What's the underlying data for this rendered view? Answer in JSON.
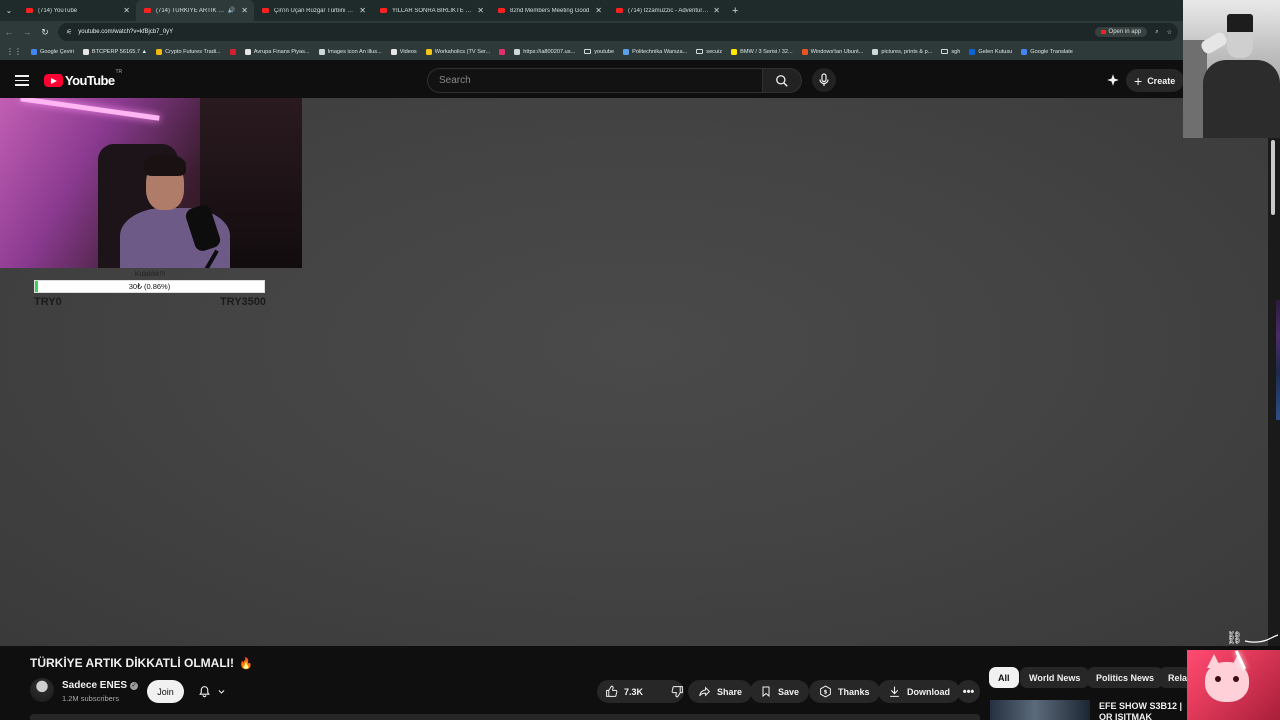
{
  "browser": {
    "tabs": [
      {
        "title": "(714) YouTube",
        "active": false
      },
      {
        "title": "(714) TÜRKİYE ARTIK DİKKATLİ",
        "active": true
      },
      {
        "title": "Çin'in Uçan Rüzgar Türbini Rek",
        "active": false
      },
      {
        "title": "YILLAR SONRA BİRLİKTE DENEY",
        "active": false
      },
      {
        "title": "82nd Members Meeting Good",
        "active": false
      },
      {
        "title": "(714) Izzamuzzic - Adventure (I",
        "active": false
      }
    ],
    "url": "youtube.com/watch?v=kfBjcb7_0yY",
    "open_in_app_label": "Open in app",
    "bookmarks": [
      {
        "label": "Google Çeviri",
        "icon": "google-translate-icon",
        "color": "#4285f4"
      },
      {
        "label": "BTCPERP 56165.7 ▲",
        "icon": "tradingview-icon",
        "color": "#e6e6e6"
      },
      {
        "label": "Crypto Futures Tradi...",
        "icon": "binance-icon",
        "color": "#f0b90b"
      },
      {
        "label": "",
        "icon": "flag-icon",
        "color": "#d61f2c"
      },
      {
        "label": "Avrupa Finans Piyas...",
        "icon": "investing-icon",
        "color": "#e6e6e6"
      },
      {
        "label": "Images icon An illus...",
        "icon": "page-icon",
        "color": "#cfd8d8"
      },
      {
        "label": "Videos",
        "icon": "video-icon",
        "color": "#e6e6e6"
      },
      {
        "label": "Workaholics (TV Ser...",
        "icon": "imdb-icon",
        "color": "#f5c518"
      },
      {
        "label": "",
        "icon": "instagram-icon",
        "color": "#e1306c"
      },
      {
        "label": "https://ia800207.us...",
        "icon": "archive-icon",
        "color": "#cfd8d8"
      },
      {
        "label": "youtube",
        "icon": "folder-icon",
        "color": ""
      },
      {
        "label": "Politechnika Warsza...",
        "icon": "globe-icon",
        "color": "#5aa0e6"
      },
      {
        "label": "secuiz",
        "icon": "folder-icon",
        "color": ""
      },
      {
        "label": "BMW / 3 Serisi / 32...",
        "icon": "sahibinden-icon",
        "color": "#ffe800"
      },
      {
        "label": "Windows'tan Ubunt...",
        "icon": "ubuntu-icon",
        "color": "#e95420"
      },
      {
        "label": "pictures, prints & p...",
        "icon": "pin-icon",
        "color": "#cfd8d8"
      },
      {
        "label": "sgh",
        "icon": "folder-icon",
        "color": ""
      },
      {
        "label": "Gelen Kutusu",
        "icon": "outlook-icon",
        "color": "#0a64d6"
      },
      {
        "label": "Google Translate",
        "icon": "google-translate-icon",
        "color": "#4285f4"
      }
    ]
  },
  "youtube": {
    "logo_text": "YouTube",
    "country_code": "TR",
    "search_placeholder": "Search",
    "create_label": "Create"
  },
  "overlay": {
    "donation_goal_label": "Kulaklık!!!",
    "donation_progress_text": "30₺ (0.86%)",
    "donation_progress_fraction": 0.0086,
    "donation_min": "TRY0",
    "donation_max": "TRY3500"
  },
  "video": {
    "title": "TÜRKİYE ARTIK DİKKATLİ OLMALI!",
    "title_emoji": "🔥",
    "channel_name": "Sadece ENES",
    "subscribers": "1.2M subscribers",
    "join_label": "Join",
    "likes": "7.3K",
    "share_label": "Share",
    "save_label": "Save",
    "thanks_label": "Thanks",
    "download_label": "Download"
  },
  "chips": [
    "All",
    "World News",
    "Politics News",
    "Relat"
  ],
  "recommendation": {
    "title": "EFE SHOW S3B12 | OR IŞITMAK"
  },
  "colors": {
    "youtube_red": "#ff0033",
    "player_gray": "#444444",
    "progress_green": "#3ad05a"
  }
}
